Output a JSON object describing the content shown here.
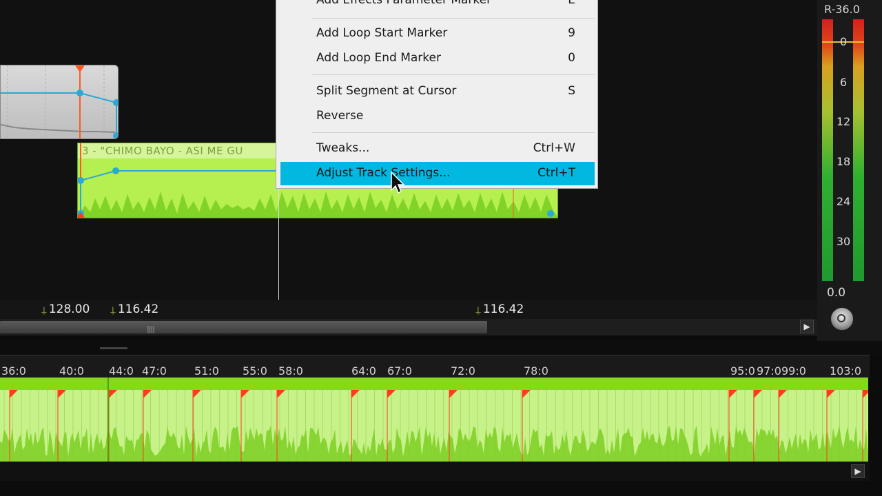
{
  "context_menu": {
    "items": [
      {
        "label": "Add Effects Parameter Marker",
        "shortcut": "E"
      },
      {
        "label": "Add Loop Start Marker",
        "shortcut": "9"
      },
      {
        "label": "Add Loop End Marker",
        "shortcut": "0"
      },
      {
        "label": "Split Segment at Cursor",
        "shortcut": "S"
      },
      {
        "label": "Reverse",
        "shortcut": ""
      },
      {
        "label": "Tweaks...",
        "shortcut": "Ctrl+W"
      },
      {
        "label": "Adjust Track Settings...",
        "shortcut": "Ctrl+T",
        "highlighted": true
      }
    ]
  },
  "tracks": {
    "green_segment_title": "3 - \"CHIMO BAYO - ASI ME GU"
  },
  "markers": {
    "m1": "128.00",
    "m2": "116.42",
    "m3": "116.42"
  },
  "meter": {
    "label": "R-36.0",
    "ticks": [
      "0",
      "6",
      "12",
      "18",
      "24",
      "30"
    ],
    "value": "0.0"
  },
  "ruler": {
    "labels": [
      "36:0",
      "40:0",
      "44:0",
      "47:0",
      "51:0",
      "55:0",
      "58:0",
      "64:0",
      "67:0",
      "72:0",
      "78:0",
      "95:0",
      "97:0",
      "99:0",
      "103:0"
    ]
  },
  "colors": {
    "highlight": "#00b8e0",
    "segment_green": "#b6ef50",
    "overview_green": "#86d81a",
    "automation_line": "#2aa8d8",
    "marker_red": "#ff3b1a"
  },
  "icons": {
    "marker_pin": "⍊",
    "scroll_right": "▶",
    "grip": "||||"
  }
}
